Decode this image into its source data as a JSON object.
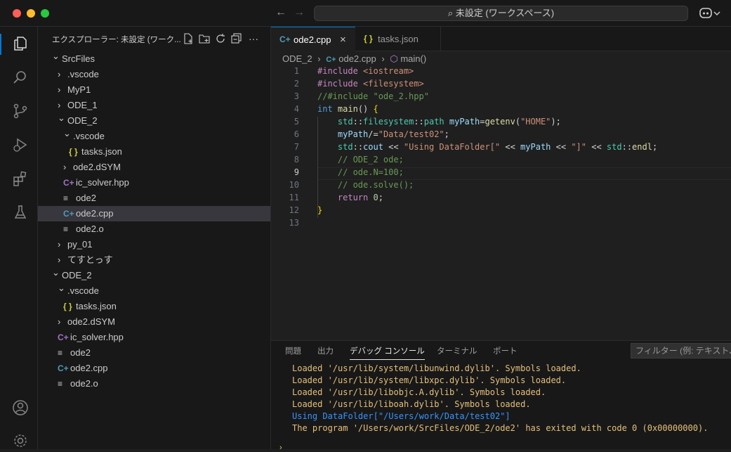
{
  "window": {
    "command_center": "⌕ 未設定 (ワークスペース)",
    "colors": {
      "close": "#ff5f57",
      "minimize": "#febc2e",
      "maximize": "#28c840",
      "accent": "#0078d4"
    }
  },
  "activity_bar": {
    "items": [
      "explorer-icon",
      "search-icon",
      "source-control-icon",
      "run-debug-icon",
      "extensions-icon",
      "testing-icon",
      "account-icon",
      "settings-icon"
    ]
  },
  "sidebar": {
    "title": "エクスプローラー: 未設定 (ワーク...",
    "tree": [
      {
        "label": "SrcFiles",
        "type": "folder-open",
        "indent": 0
      },
      {
        "label": ".vscode",
        "type": "folder",
        "indent": 1
      },
      {
        "label": "MyP1",
        "type": "folder",
        "indent": 1
      },
      {
        "label": "ODE_1",
        "type": "folder",
        "indent": 1
      },
      {
        "label": "ODE_2",
        "type": "folder-open",
        "indent": 1
      },
      {
        "label": ".vscode",
        "type": "folder-open",
        "indent": 2
      },
      {
        "label": "tasks.json",
        "type": "json",
        "indent": 3
      },
      {
        "label": "ode2.dSYM",
        "type": "folder",
        "indent": 2
      },
      {
        "label": "ic_solver.hpp",
        "type": "cpp-header",
        "indent": 2
      },
      {
        "label": "ode2",
        "type": "file",
        "indent": 2
      },
      {
        "label": "ode2.cpp",
        "type": "cpp",
        "indent": 2,
        "selected": true
      },
      {
        "label": "ode2.o",
        "type": "file",
        "indent": 2
      },
      {
        "label": "py_01",
        "type": "folder",
        "indent": 1
      },
      {
        "label": "てすとっす",
        "type": "folder",
        "indent": 1
      },
      {
        "label": "ODE_2",
        "type": "folder-open",
        "indent": 0
      },
      {
        "label": ".vscode",
        "type": "folder-open",
        "indent": 1
      },
      {
        "label": "tasks.json",
        "type": "json",
        "indent": 2
      },
      {
        "label": "ode2.dSYM",
        "type": "folder",
        "indent": 1
      },
      {
        "label": "ic_solver.hpp",
        "type": "cpp-header",
        "indent": 1
      },
      {
        "label": "ode2",
        "type": "file",
        "indent": 1
      },
      {
        "label": "ode2.cpp",
        "type": "cpp",
        "indent": 1
      },
      {
        "label": "ode2.o",
        "type": "file",
        "indent": 1
      }
    ]
  },
  "tabs": [
    {
      "label": "ode2.cpp",
      "icon": "cpp-icon",
      "close": "×"
    },
    {
      "label": "tasks.json",
      "icon": "json-icon"
    }
  ],
  "breadcrumb": {
    "folder": "ODE_2",
    "file": "ode2.cpp",
    "symbol": "main()"
  },
  "editor": {
    "current_line": 9,
    "lines": [
      {
        "n": "1",
        "tokens": [
          [
            "kw",
            "#include "
          ],
          [
            "str",
            "<iostream>"
          ]
        ]
      },
      {
        "n": "2",
        "tokens": [
          [
            "kw",
            "#include "
          ],
          [
            "str",
            "<filesystem>"
          ]
        ]
      },
      {
        "n": "3",
        "tokens": [
          [
            "cm",
            "//#include \"ode_2.hpp\""
          ]
        ]
      },
      {
        "n": "4",
        "tokens": [
          [
            "ty",
            "int "
          ],
          [
            "fn",
            "main"
          ],
          [
            "op",
            "() "
          ],
          [
            "br",
            "{"
          ]
        ]
      },
      {
        "n": "5",
        "tokens": [
          [
            "op",
            "    "
          ],
          [
            "ns",
            "std"
          ],
          [
            "op",
            "::"
          ],
          [
            "ns",
            "filesystem"
          ],
          [
            "op",
            "::"
          ],
          [
            "ns",
            "path "
          ],
          [
            "var",
            "myPath"
          ],
          [
            "op",
            "="
          ],
          [
            "fn",
            "getenv"
          ],
          [
            "op",
            "("
          ],
          [
            "str",
            "\"HOME\""
          ],
          [
            "op",
            ");"
          ]
        ]
      },
      {
        "n": "6",
        "tokens": [
          [
            "op",
            "    "
          ],
          [
            "var",
            "myPath"
          ],
          [
            "op",
            "/="
          ],
          [
            "str",
            "\"Data/test02\""
          ],
          [
            "op",
            ";"
          ]
        ]
      },
      {
        "n": "7",
        "tokens": [
          [
            "op",
            "    "
          ],
          [
            "ns",
            "std"
          ],
          [
            "op",
            "::"
          ],
          [
            "var",
            "cout"
          ],
          [
            "op",
            " << "
          ],
          [
            "str",
            "\"Using DataFolder[\""
          ],
          [
            "op",
            " << "
          ],
          [
            "var",
            "myPath"
          ],
          [
            "op",
            " << "
          ],
          [
            "str",
            "\"]\""
          ],
          [
            "op",
            " << "
          ],
          [
            "ns",
            "std"
          ],
          [
            "op",
            "::"
          ],
          [
            "fn",
            "endl"
          ],
          [
            "op",
            ";"
          ]
        ]
      },
      {
        "n": "8",
        "tokens": [
          [
            "op",
            "    "
          ],
          [
            "cm",
            "// ODE_2 ode;"
          ]
        ]
      },
      {
        "n": "9",
        "tokens": [
          [
            "op",
            "    "
          ],
          [
            "cm",
            "// ode.N=100;"
          ]
        ]
      },
      {
        "n": "10",
        "tokens": [
          [
            "op",
            "    "
          ],
          [
            "cm",
            "// ode.solve();"
          ]
        ]
      },
      {
        "n": "11",
        "tokens": [
          [
            "op",
            "    "
          ],
          [
            "kw",
            "return "
          ],
          [
            "num",
            "0"
          ],
          [
            "op",
            ";"
          ]
        ]
      },
      {
        "n": "12",
        "tokens": [
          [
            "br",
            "}"
          ]
        ]
      },
      {
        "n": "13",
        "tokens": []
      }
    ]
  },
  "panel": {
    "tabs": [
      "問題",
      "出力",
      "デバッグ コンソール",
      "ターミナル",
      "ポート"
    ],
    "active_tab": 2,
    "filter_placeholder": "フィルター (例: テキスト、!除外)",
    "output": [
      {
        "text": "Loaded '/usr/lib/system/libunwind.dylib'. Symbols loaded.",
        "color": "#e5c07b"
      },
      {
        "text": "Loaded '/usr/lib/system/libxpc.dylib'. Symbols loaded.",
        "color": "#e5c07b"
      },
      {
        "text": "Loaded '/usr/lib/libobjc.A.dylib'. Symbols loaded.",
        "color": "#e5c07b"
      },
      {
        "text": "Loaded '/usr/lib/liboah.dylib'. Symbols loaded.",
        "color": "#e5c07b"
      },
      {
        "text": "Using DataFolder[\"/Users/work/Data/test02\"]",
        "color": "#3794ff"
      },
      {
        "text": "The program '/Users/work/SrcFiles/ODE_2/ode2' has exited with code 0 (0x00000000).",
        "color": "#e5c07b"
      }
    ]
  }
}
